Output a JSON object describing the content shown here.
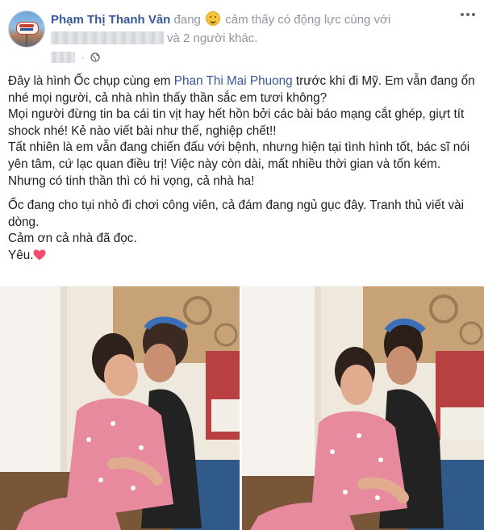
{
  "header": {
    "author": "Phạm Thị Thanh Vân",
    "activity_before_emoji": "đang",
    "activity_after_emoji": "cảm thấy có động lực cùng với",
    "others": "và 2 người khác.",
    "emoji": "smiling-face-icon",
    "privacy_icon": "globe-icon",
    "menu_icon": "more-options-icon"
  },
  "body": {
    "p1_before": "Đây là hình Ốc chụp cùng em ",
    "mention": "Phan Thi Mai Phuong",
    "p1_after": " trước khi đi Mỹ. Em vẫn đang ổn nhé mọi người, cả nhà nhìn thấy thần sắc em tươi không?",
    "p2": "Mọi người đừng tin ba cái tin vịt hay hết hồn bởi các bài báo mạng cắt ghép, giựt tít shock nhé! Kẻ nào viết bài như thế, nghiệp chết!!",
    "p3": "Tất nhiên là em vẫn đang chiến đấu với bệnh, nhưng hiện tại tình hình tốt, bác sĩ nói yên tâm, cứ lạc quan điều trị! Việc này còn dài, mất nhiều thời gian và tốn kém. Nhưng có tinh thần thì có hi vọng, cả nhà ha!",
    "p4": "Ốc đang cho tụi nhỏ đi chơi công viên, cả đám đang ngủ gục đây. Tranh thủ viết vài dòng.",
    "p5": "Cảm ơn cả nhà đã đọc.",
    "p6": "Yêu.",
    "heart_icon": "red-heart-icon"
  },
  "colors": {
    "link": "#385898",
    "secondary_text": "#90949c",
    "heart": "#f0506e"
  }
}
